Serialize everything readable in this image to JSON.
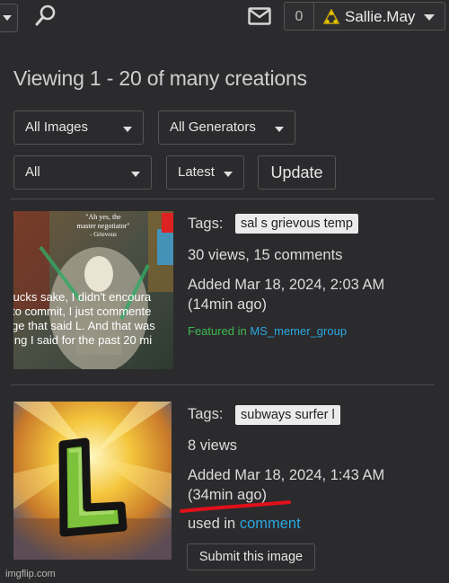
{
  "header": {
    "notification_count": "0",
    "username": "Sallie.May"
  },
  "page_title": "Viewing 1 - 20 of many creations",
  "filters": {
    "images": "All Images",
    "generators": "All Generators",
    "scope": "All",
    "sort": "Latest",
    "update_label": "Update"
  },
  "items": [
    {
      "tags_label": "Tags:",
      "tag": "sal s grievous temp",
      "stats": "30 views, 15 comments",
      "added": "Added Mar 18, 2024, 2:03 AM",
      "ago": "(14min ago)",
      "featured_prefix": "Featured in",
      "featured_group": "MS_memer_group",
      "thumb_text": {
        "quote_line1": "\"Ah yes, the",
        "quote_line2": "master negotiator\"",
        "quote_line3": "- Grievous",
        "caption_line1": " fucks sake, I didn't encoura",
        "caption_line2": "to commit, I just commente",
        "caption_line3": "ge that said L. And that was",
        "caption_line4": "ing I said for the past 20 mi"
      }
    },
    {
      "tags_label": "Tags:",
      "tag": "subways surfer l",
      "stats": "8 views",
      "added": "Added Mar 18, 2024, 1:43 AM",
      "ago": "(34min ago)",
      "used_prefix": "used in",
      "used_link": "comment",
      "submit_label": "Submit this image"
    }
  ],
  "watermark": "imgflip.com",
  "icons": [
    "search-icon",
    "mail-icon",
    "avatar-icon",
    "chevron-down-icon"
  ]
}
